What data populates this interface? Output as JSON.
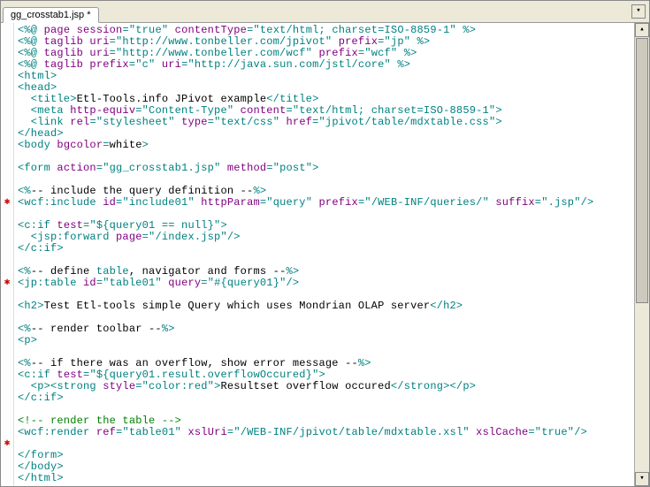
{
  "tab": {
    "label": "gg_crosstab1.jsp *"
  },
  "error_marker_glyph": "✱",
  "error_line_indices": [
    15,
    22,
    36
  ],
  "code_lines": [
    [
      [
        "t-tag",
        "<%@ "
      ],
      [
        "t-attr",
        "page session"
      ],
      [
        "t-tag",
        "="
      ],
      [
        "t-val",
        "\"true\""
      ],
      [
        "t-tag",
        " "
      ],
      [
        "t-attr",
        "contentType"
      ],
      [
        "t-tag",
        "="
      ],
      [
        "t-val",
        "\"text/html; charset=ISO-8859-1\""
      ],
      [
        "t-tag",
        " %>"
      ]
    ],
    [
      [
        "t-tag",
        "<%@ "
      ],
      [
        "t-attr",
        "taglib uri"
      ],
      [
        "t-tag",
        "="
      ],
      [
        "t-val",
        "\"http://www.tonbeller.com/jpivot\""
      ],
      [
        "t-tag",
        " "
      ],
      [
        "t-attr",
        "prefix"
      ],
      [
        "t-tag",
        "="
      ],
      [
        "t-val",
        "\"jp\""
      ],
      [
        "t-tag",
        " %>"
      ]
    ],
    [
      [
        "t-tag",
        "<%@ "
      ],
      [
        "t-attr",
        "taglib uri"
      ],
      [
        "t-tag",
        "="
      ],
      [
        "t-val",
        "\"http://www.tonbeller.com/wcf\""
      ],
      [
        "t-tag",
        " "
      ],
      [
        "t-attr",
        "prefix"
      ],
      [
        "t-tag",
        "="
      ],
      [
        "t-val",
        "\"wcf\""
      ],
      [
        "t-tag",
        " %>"
      ]
    ],
    [
      [
        "t-tag",
        "<%@ "
      ],
      [
        "t-attr",
        "taglib prefix"
      ],
      [
        "t-tag",
        "="
      ],
      [
        "t-val",
        "\"c\""
      ],
      [
        "t-tag",
        " "
      ],
      [
        "t-attr",
        "uri"
      ],
      [
        "t-tag",
        "="
      ],
      [
        "t-val",
        "\"http://java.sun.com/jstl/core\""
      ],
      [
        "t-tag",
        " %>"
      ]
    ],
    [
      [
        "t-tag",
        "<html>"
      ]
    ],
    [
      [
        "t-tag",
        "<head>"
      ]
    ],
    [
      [
        "t-tag",
        "  <title>"
      ],
      [
        "t-text",
        "Etl-Tools.info JPivot example"
      ],
      [
        "t-tag",
        "</title>"
      ]
    ],
    [
      [
        "t-tag",
        "  <meta "
      ],
      [
        "t-attr",
        "http-equiv"
      ],
      [
        "t-tag",
        "="
      ],
      [
        "t-val",
        "\"Content-Type\""
      ],
      [
        "t-tag",
        " "
      ],
      [
        "t-attr",
        "content"
      ],
      [
        "t-tag",
        "="
      ],
      [
        "t-val",
        "\"text/html; charset=ISO-8859-1\""
      ],
      [
        "t-tag",
        ">"
      ]
    ],
    [
      [
        "t-tag",
        "  <link "
      ],
      [
        "t-attr",
        "rel"
      ],
      [
        "t-tag",
        "="
      ],
      [
        "t-val",
        "\"stylesheet\""
      ],
      [
        "t-tag",
        " "
      ],
      [
        "t-attr",
        "type"
      ],
      [
        "t-tag",
        "="
      ],
      [
        "t-val",
        "\"text/css\""
      ],
      [
        "t-tag",
        " "
      ],
      [
        "t-attr",
        "href"
      ],
      [
        "t-tag",
        "="
      ],
      [
        "t-val",
        "\"jpivot/table/mdxtable.css\""
      ],
      [
        "t-tag",
        ">"
      ]
    ],
    [
      [
        "t-tag",
        "</head>"
      ]
    ],
    [
      [
        "t-tag",
        "<body "
      ],
      [
        "t-attr",
        "bgcolor"
      ],
      [
        "t-tag",
        "="
      ],
      [
        "t-text",
        "white"
      ],
      [
        "t-tag",
        ">"
      ]
    ],
    [],
    [
      [
        "t-tag",
        "<form "
      ],
      [
        "t-attr",
        "action"
      ],
      [
        "t-tag",
        "="
      ],
      [
        "t-val",
        "\"gg_crosstab1.jsp\""
      ],
      [
        "t-tag",
        " "
      ],
      [
        "t-attr",
        "method"
      ],
      [
        "t-tag",
        "="
      ],
      [
        "t-val",
        "\"post\""
      ],
      [
        "t-tag",
        ">"
      ]
    ],
    [],
    [
      [
        "t-tag",
        "<%"
      ],
      [
        "t-text",
        "-- include the query definition --"
      ],
      [
        "t-tag",
        "%>"
      ]
    ],
    [
      [
        "t-tag",
        "<wcf:include "
      ],
      [
        "t-attr",
        "id"
      ],
      [
        "t-tag",
        "="
      ],
      [
        "t-val",
        "\"include01\""
      ],
      [
        "t-tag",
        " "
      ],
      [
        "t-attr",
        "httpParam"
      ],
      [
        "t-tag",
        "="
      ],
      [
        "t-val",
        "\"query\""
      ],
      [
        "t-tag",
        " "
      ],
      [
        "t-attr",
        "prefix"
      ],
      [
        "t-tag",
        "="
      ],
      [
        "t-val",
        "\"/WEB-INF/queries/\""
      ],
      [
        "t-tag",
        " "
      ],
      [
        "t-attr",
        "suffix"
      ],
      [
        "t-tag",
        "="
      ],
      [
        "t-val",
        "\".jsp\""
      ],
      [
        "t-tag",
        "/>"
      ]
    ],
    [],
    [
      [
        "t-tag",
        "<c:if "
      ],
      [
        "t-attr",
        "test"
      ],
      [
        "t-tag",
        "="
      ],
      [
        "t-val",
        "\"${query01 == null}\""
      ],
      [
        "t-tag",
        ">"
      ]
    ],
    [
      [
        "t-tag",
        "  <jsp:forward "
      ],
      [
        "t-attr",
        "page"
      ],
      [
        "t-tag",
        "="
      ],
      [
        "t-val",
        "\"/index.jsp\""
      ],
      [
        "t-tag",
        "/>"
      ]
    ],
    [
      [
        "t-tag",
        "</c:if>"
      ]
    ],
    [],
    [
      [
        "t-tag",
        "<%"
      ],
      [
        "t-text",
        "-- define "
      ],
      [
        "t-val",
        "table"
      ],
      [
        "t-text",
        ", navigator and forms --"
      ],
      [
        "t-tag",
        "%>"
      ]
    ],
    [
      [
        "t-tag",
        "<jp:table "
      ],
      [
        "t-attr",
        "id"
      ],
      [
        "t-tag",
        "="
      ],
      [
        "t-val",
        "\"table01\""
      ],
      [
        "t-tag",
        " "
      ],
      [
        "t-attr",
        "query"
      ],
      [
        "t-tag",
        "="
      ],
      [
        "t-val",
        "\"#{query01}\""
      ],
      [
        "t-tag",
        "/>"
      ]
    ],
    [],
    [
      [
        "t-tag",
        "<h2>"
      ],
      [
        "t-text",
        "Test Etl-tools simple Query which uses Mondrian OLAP server"
      ],
      [
        "t-tag",
        "</h2>"
      ]
    ],
    [],
    [
      [
        "t-tag",
        "<%"
      ],
      [
        "t-text",
        "-- render toolbar --"
      ],
      [
        "t-tag",
        "%>"
      ]
    ],
    [
      [
        "t-tag",
        "<p>"
      ]
    ],
    [],
    [
      [
        "t-tag",
        "<%"
      ],
      [
        "t-text",
        "-- if there was an overflow, show error message --"
      ],
      [
        "t-tag",
        "%>"
      ]
    ],
    [
      [
        "t-tag",
        "<c:if "
      ],
      [
        "t-attr",
        "test"
      ],
      [
        "t-tag",
        "="
      ],
      [
        "t-val",
        "\"${query01.result.overflowOccured}\""
      ],
      [
        "t-tag",
        ">"
      ]
    ],
    [
      [
        "t-tag",
        "  <p><strong "
      ],
      [
        "t-attr",
        "style"
      ],
      [
        "t-tag",
        "="
      ],
      [
        "t-val",
        "\"color:red\""
      ],
      [
        "t-tag",
        ">"
      ],
      [
        "t-text",
        "Resultset overflow occured"
      ],
      [
        "t-tag",
        "</strong></p>"
      ]
    ],
    [
      [
        "t-tag",
        "</c:if>"
      ]
    ],
    [],
    [
      [
        "t-cmt",
        "<!-- render the table -->"
      ]
    ],
    [
      [
        "t-tag",
        "<wcf:render "
      ],
      [
        "t-attr",
        "ref"
      ],
      [
        "t-tag",
        "="
      ],
      [
        "t-val",
        "\"table01\""
      ],
      [
        "t-tag",
        " "
      ],
      [
        "t-attr",
        "xslUri"
      ],
      [
        "t-tag",
        "="
      ],
      [
        "t-val",
        "\"/WEB-INF/jpivot/table/mdxtable.xsl\""
      ],
      [
        "t-tag",
        " "
      ],
      [
        "t-attr",
        "xslCache"
      ],
      [
        "t-tag",
        "="
      ],
      [
        "t-val",
        "\"true\""
      ],
      [
        "t-tag",
        "/>"
      ]
    ],
    [],
    [
      [
        "t-tag",
        "</form>"
      ]
    ],
    [
      [
        "t-tag",
        "</body>"
      ]
    ],
    [
      [
        "t-tag",
        "</html>"
      ]
    ]
  ]
}
